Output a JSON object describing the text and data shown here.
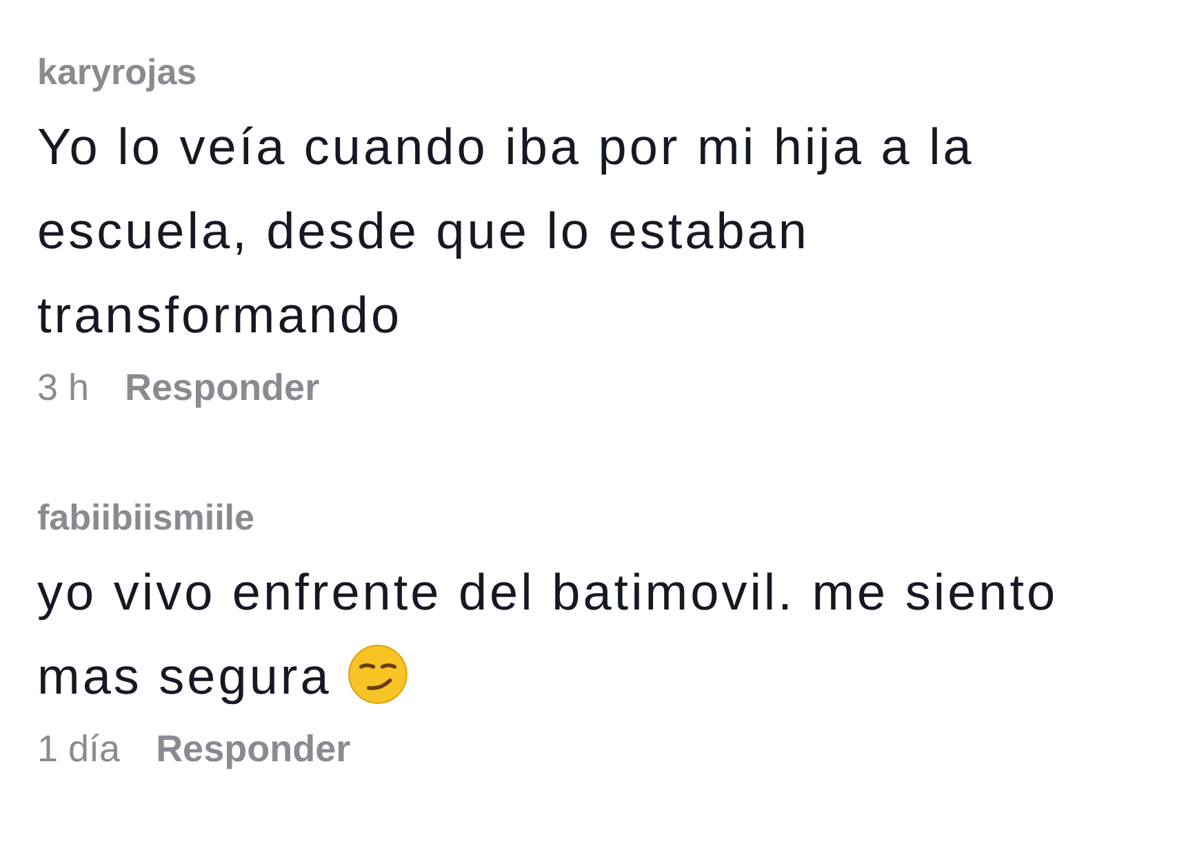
{
  "comments": [
    {
      "username": "karyrojas",
      "text": "Yo lo veía cuando iba por mi hija a la escuela, desde que lo estaban transformando",
      "time": "3 h",
      "reply": "Responder"
    },
    {
      "username": "fabiibiismiile",
      "text": "yo vivo enfrente del batimovil. me siento mas segura",
      "emoji": true,
      "time": "1 día",
      "reply": "Responder"
    }
  ]
}
